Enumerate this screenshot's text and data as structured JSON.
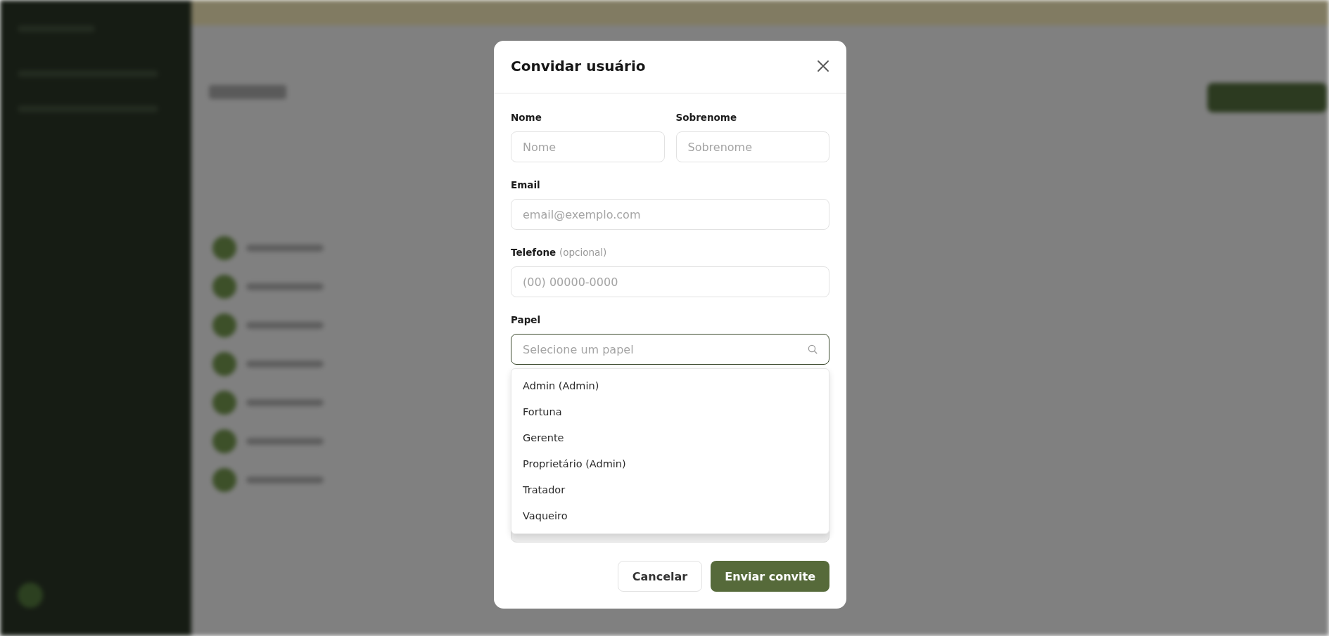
{
  "dialog": {
    "title": "Convidar usuário",
    "name_row": [
      {
        "label": "Nome",
        "placeholder": "Nome"
      },
      {
        "label": "Sobrenome",
        "placeholder": "Sobrenome"
      }
    ],
    "fields": [
      {
        "kind": "text",
        "label": "Email",
        "placeholder": "email@exemplo.com"
      },
      {
        "kind": "text",
        "label": "Telefone",
        "note": "(opcional)",
        "placeholder": "(00) 00000-0000"
      },
      {
        "kind": "select",
        "label": "Papel",
        "placeholder": "Selecione um papel",
        "focused": true,
        "expanded": true
      }
    ],
    "options": [
      "Admin (Admin)",
      "Fortuna",
      "Gerente",
      "Proprietário (Admin)",
      "Tratador",
      "Vaqueiro"
    ],
    "buttons": [
      {
        "kind": "secondary",
        "label": "Cancelar"
      },
      {
        "kind": "primary",
        "label": "Enviar convite"
      }
    ]
  }
}
